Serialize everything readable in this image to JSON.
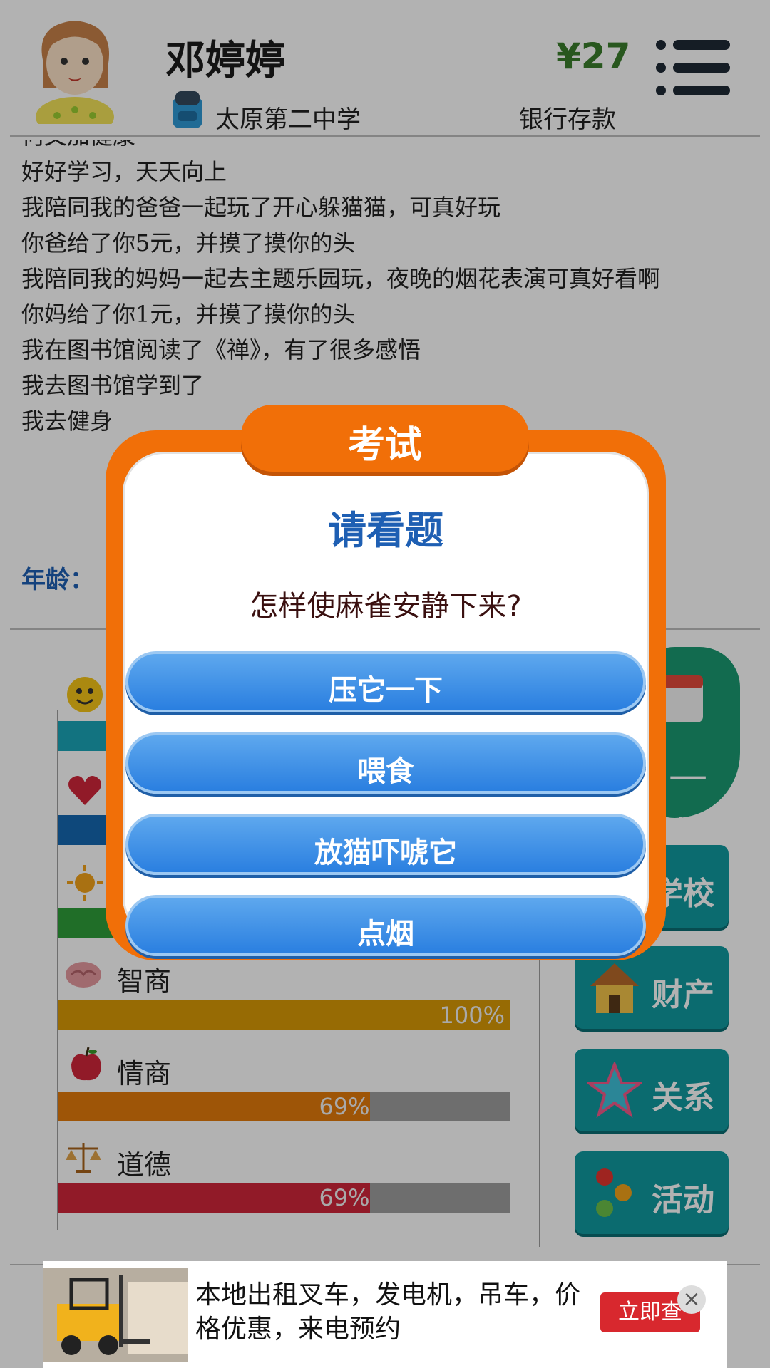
{
  "profile": {
    "name": "邓婷婷",
    "school": "太原第二中学",
    "money": "¥27",
    "bank_label": "银行存款"
  },
  "log": {
    "cut_line": "何父加健康",
    "lines": [
      "好好学习，天天向上",
      "我陪同我的爸爸一起玩了开心躲猫猫，可真好玩",
      "你爸给了你5元，并摸了摸你的头",
      "我陪同我的妈妈一起去主题乐园玩，夜晚的烟花表演可真好看啊",
      "你妈给了你1元，并摸了摸你的头",
      "我在图书馆阅读了《禅》，有了很多感悟",
      "我去图书馆学到了",
      "我去健身"
    ]
  },
  "age_label": "年龄：",
  "stats": [
    {
      "label": "",
      "icon": "smiley-icon",
      "percent": 100,
      "color": "#1aa5b8"
    },
    {
      "label": "",
      "icon": "heart-icon",
      "percent": 100,
      "color": "#1567b0"
    },
    {
      "label": "",
      "icon": "sun-icon",
      "percent": 100,
      "color": "#2e9e3a"
    },
    {
      "label": "智商",
      "icon": "brain-icon",
      "percent": 100,
      "percent_text": "100%",
      "color": "#d89a07"
    },
    {
      "label": "情商",
      "icon": "apple-icon",
      "percent": 69,
      "percent_text": "69%",
      "color": "#e27a0b"
    },
    {
      "label": "道德",
      "icon": "scales-icon",
      "percent": 69,
      "percent_text": "69%",
      "color": "#d0263a"
    }
  ],
  "nav": {
    "year_label": "一年",
    "school_label": "学校",
    "property_label": "财产",
    "relation_label": "关系",
    "activity_label": "活动"
  },
  "dialog": {
    "title": "考试",
    "heading": "请看题",
    "question": "怎样使麻雀安静下来?",
    "answers": [
      "压它一下",
      "喂食",
      "放猫吓唬它",
      "点烟"
    ]
  },
  "ad": {
    "text": "本地出租叉车，发电机，吊车，价格优惠，来电预约",
    "cta": "立即查",
    "close": "×"
  },
  "colors": {
    "dialog_orange": "#f16f08",
    "answer_blue": "#2a7fe0",
    "nav_teal": "#119aa0"
  }
}
